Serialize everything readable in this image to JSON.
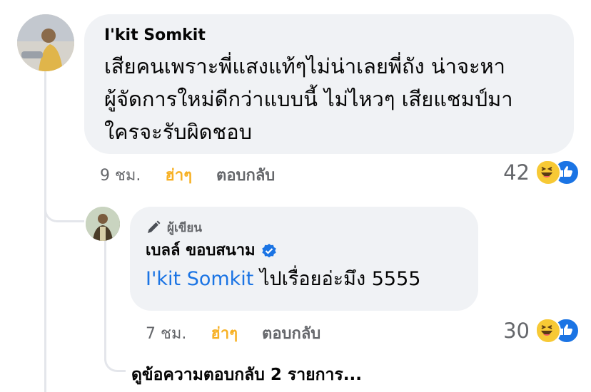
{
  "comment": {
    "author": "I'kit Somkit",
    "text": "เสียคนเพราะพี่แสงแท้ๆไม่น่าเลยพี่ถัง น่าจะหา\nผู้จัดการใหม่ดีกว่าแบบนี้ ไม่ไหวๆ เสียแชมป์มา\nใครจะรับผิดชอบ",
    "time": "9 ชม.",
    "reaction_label": "ฮ่าๆ",
    "reply_label": "ตอบกลับ",
    "reaction_count": "42",
    "reaction_icons": [
      "haha-icon",
      "like-icon"
    ]
  },
  "reply": {
    "badge_label": "ผู้เขียน",
    "author": "เบลล์ ขอบสนาม",
    "verified": true,
    "mention": "I'kit Somkit",
    "text": " ไปเรื่อยอ่ะมึง 5555",
    "time": "7 ชม.",
    "reaction_label": "ฮ่าๆ",
    "reply_label": "ตอบกลับ",
    "reaction_count": "30",
    "reaction_icons": [
      "haha-icon",
      "like-icon"
    ]
  },
  "view_more_replies": "ดูข้อความตอบกลับ 2 รายการ...",
  "colors": {
    "bubble": "#f0f2f5",
    "mention": "#1b74e4",
    "haha": "#f7b125",
    "secondary_text": "#65676b",
    "verified": "#1b74e4"
  }
}
